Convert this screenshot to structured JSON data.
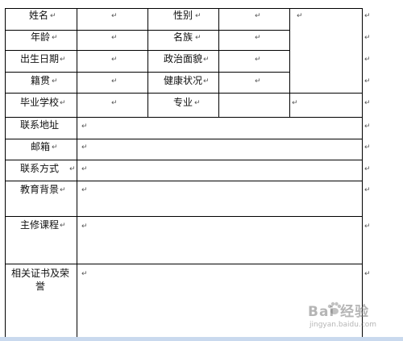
{
  "form": {
    "labels": {
      "name": "姓名",
      "gender": "性别",
      "age": "年龄",
      "ethnicity": "名族",
      "birthdate": "出生日期",
      "political_status": "政治面貌",
      "native_place": "籍贯",
      "health": "健康状况",
      "school": "毕业学校",
      "major": "专业",
      "address": "联系地址",
      "email": "邮箱",
      "contact": "联系方式",
      "education": "教育背景",
      "courses": "主修课程",
      "certificates": "相关证书及荣誉"
    },
    "paragraph_mark": "↵"
  },
  "watermark": {
    "brand": "Bai 经验",
    "url": "jingyan.baidu.com"
  },
  "colors": {
    "grid": "#000000",
    "text": "#111111",
    "bottom_bar": "#c9d9ee"
  }
}
